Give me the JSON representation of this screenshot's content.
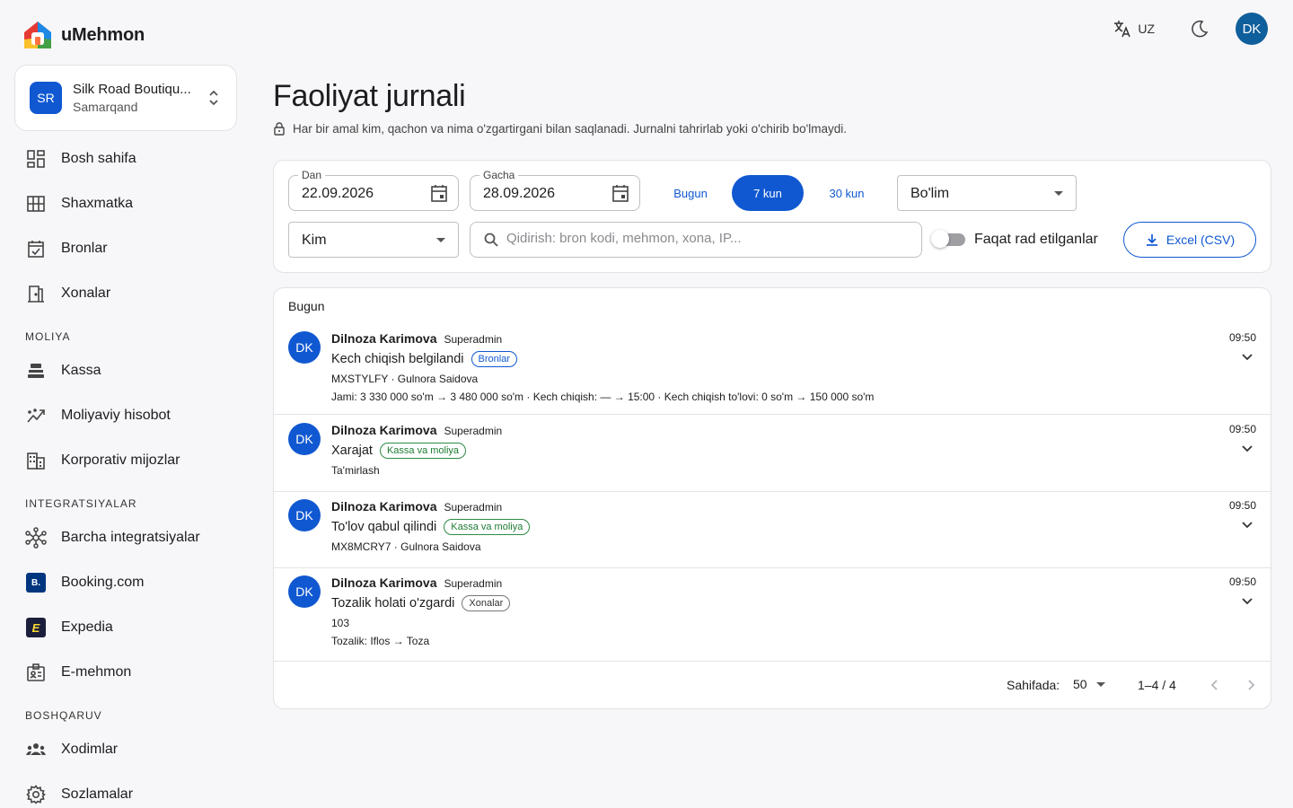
{
  "app": {
    "name": "uMehmon"
  },
  "hotel": {
    "initials": "SR",
    "name": "Silk Road Boutiqu...",
    "city": "Samarqand"
  },
  "sidebar": {
    "items": [
      {
        "label": "Bosh sahifa",
        "icon": "dashboard-icon"
      },
      {
        "label": "Shaxmatka",
        "icon": "grid-icon"
      },
      {
        "label": "Bronlar",
        "icon": "calendar-check-icon"
      },
      {
        "label": "Xonalar",
        "icon": "door-icon"
      }
    ],
    "section_finance": "MOLIYA",
    "finance_items": [
      {
        "label": "Kassa",
        "icon": "cash-register-icon"
      },
      {
        "label": "Moliyaviy hisobot",
        "icon": "trend-icon"
      },
      {
        "label": "Korporativ mijozlar",
        "icon": "building-icon"
      }
    ],
    "section_integrations": "INTEGRATSIYALAR",
    "integration_items": [
      {
        "label": "Barcha integratsiyalar",
        "icon": "hub-icon"
      },
      {
        "label": "Booking.com",
        "icon": "booking-logo-icon",
        "logo_text": "B."
      },
      {
        "label": "Expedia",
        "icon": "expedia-logo-icon",
        "logo_text": "E"
      },
      {
        "label": "E-mehmon",
        "icon": "badge-icon"
      }
    ],
    "section_admin": "BOSHQARUV",
    "admin_items": [
      {
        "label": "Xodimlar",
        "icon": "people-icon"
      },
      {
        "label": "Sozlamalar",
        "icon": "gear-icon"
      }
    ]
  },
  "topbar": {
    "language": "UZ",
    "user_initials": "DK"
  },
  "page": {
    "title": "Faoliyat jurnali",
    "subtitle": "Har bir amal kim, qachon va nima o'zgartirgani bilan saqlanadi. Jurnalni tahrirlab yoki o'chirib bo'lmaydi."
  },
  "filters": {
    "from_label": "Dan",
    "from_value": "22.09.2026",
    "to_label": "Gacha",
    "to_value": "28.09.2026",
    "ranges": [
      "Bugun",
      "7 kun",
      "30 kun"
    ],
    "active_range": "7 kun",
    "section_select": "Bo'lim",
    "who_select": "Kim",
    "search_placeholder": "Qidirish: bron kodi, mehmon, xona, IP...",
    "rejected_only_label": "Faqat rad etilganlar",
    "rejected_only": false,
    "export_label": "Excel (CSV)"
  },
  "log": {
    "group_label": "Bugun",
    "entries": [
      {
        "initials": "DK",
        "user": "Dilnoza Karimova",
        "role": "Superadmin",
        "action": "Kech chiqish belgilandi",
        "tag": "Bronlar",
        "tag_color": "#1058d1",
        "line1": "MXSTYLFY · Gulnora Saidova",
        "line2": "Jami: 3 330 000 so'm → 3 480 000 so'm · Kech chiqish: — → 15:00 · Kech chiqish to'lovi: 0 so'm → 150 000 so'm",
        "time": "09:50"
      },
      {
        "initials": "DK",
        "user": "Dilnoza Karimova",
        "role": "Superadmin",
        "action": "Xarajat",
        "tag": "Kassa va moliya",
        "tag_color": "#2e8b45",
        "line1": "Ta'mirlash",
        "line2": "",
        "time": "09:50"
      },
      {
        "initials": "DK",
        "user": "Dilnoza Karimova",
        "role": "Superadmin",
        "action": "To'lov qabul qilindi",
        "tag": "Kassa va moliya",
        "tag_color": "#2e8b45",
        "line1": "MX8MCRY7 · Gulnora Saidova",
        "line2": "",
        "time": "09:50"
      },
      {
        "initials": "DK",
        "user": "Dilnoza Karimova",
        "role": "Superadmin",
        "action": "Tozalik holati o'zgardi",
        "tag": "Xonalar",
        "tag_color": "#777777",
        "line1": "103",
        "line2": "Tozalik: Iflos → Toza",
        "time": "09:50"
      }
    ]
  },
  "pagination": {
    "rows_label": "Sahifada:",
    "rows_per_page": "50",
    "range": "1–4 / 4"
  },
  "colors": {
    "primary": "#1058d1",
    "avatar_user": "#0f5f9c",
    "success": "#2e8b45"
  }
}
